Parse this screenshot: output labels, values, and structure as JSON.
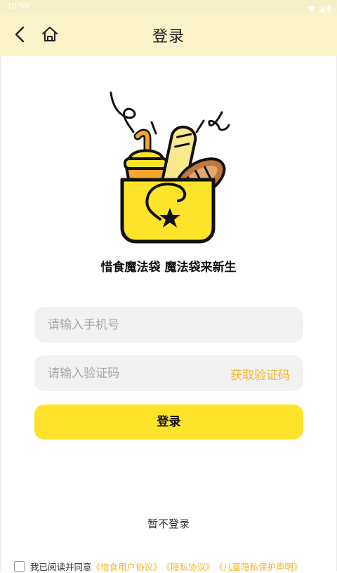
{
  "status_bar": {
    "time": "10:58",
    "icons": [
      "wifi-icon",
      "signal-icon",
      "battery-icon"
    ]
  },
  "header": {
    "title": "登录",
    "back_icon": "chevron-left-icon",
    "home_icon": "home-icon"
  },
  "hero": {
    "slogan": "惜食魔法袋  魔法袋来新生"
  },
  "form": {
    "phone_placeholder": "请输入手机号",
    "phone_value": "",
    "code_placeholder": "请输入验证码",
    "code_value": "",
    "get_code_label": "获取验证码",
    "login_label": "登录"
  },
  "skip_label": "暂不登录",
  "agreement": {
    "checked": false,
    "prefix": "我已阅读并同意",
    "links": [
      "《惜食用户协议》",
      "《隐私协议》",
      "《儿童隐私保护声明》"
    ]
  },
  "colors": {
    "header_bg": "#faf3c8",
    "accent_yellow": "#fde42b",
    "link_orange": "#f0b731",
    "input_bg": "#f2f2f2"
  }
}
